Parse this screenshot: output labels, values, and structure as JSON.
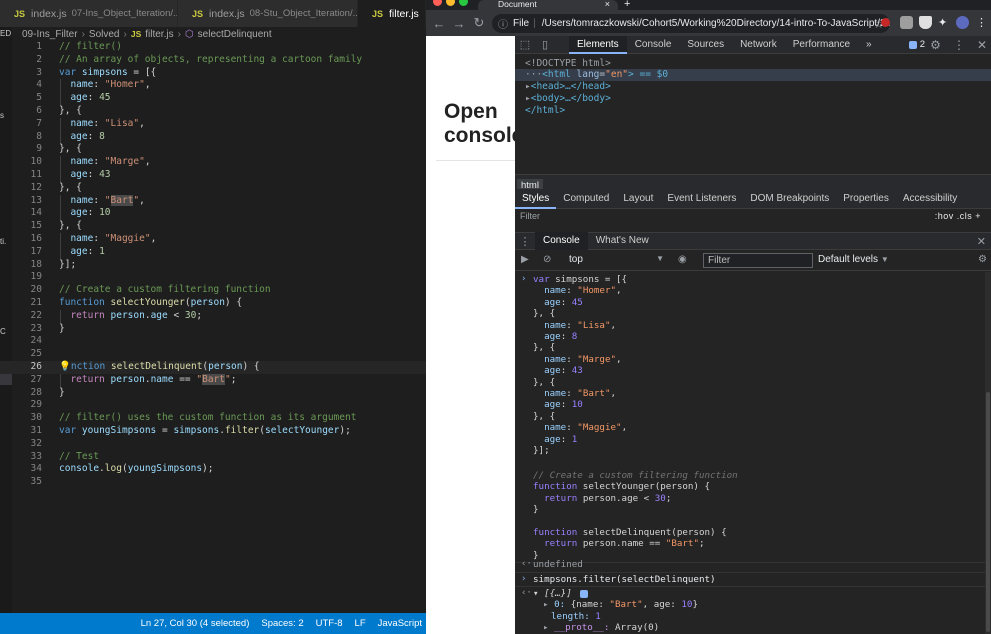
{
  "vscode": {
    "tabs": [
      {
        "icon": "JS",
        "name": "index.js",
        "dir": "07-Ins_Object_Iteration/...",
        "dirty": true
      },
      {
        "icon": "JS",
        "name": "index.js",
        "dir": "08-Stu_Object_Iteration/...",
        "close": "×"
      },
      {
        "icon": "JS",
        "name": "filter.js",
        "active": true
      }
    ],
    "side_letters": [
      "ED",
      "s",
      "ti.",
      "C"
    ],
    "breadcrumb": [
      "09-Ins_Filter",
      "Solved",
      "JS",
      "filter.js",
      "selectDelinquent"
    ],
    "lines": [
      "1",
      "2",
      "3",
      "4",
      "5",
      "6",
      "7",
      "8",
      "9",
      "10",
      "11",
      "12",
      "13",
      "14",
      "15",
      "16",
      "17",
      "18",
      "19",
      "20",
      "21",
      "22",
      "23",
      "24",
      "25",
      "26",
      "27",
      "28",
      "29",
      "30",
      "31",
      "32",
      "33",
      "34",
      "35"
    ],
    "code": {
      "l1": "// filter()",
      "l2": "// An array of objects, representing a cartoon family",
      "l3_kw": "var",
      "l3_var": "simpsons",
      "l3_rest": " = [{",
      "name_key": "name",
      "age_key": "age",
      "homer": "\"Homer\"",
      "age45": "45",
      "lisa": "\"Lisa\"",
      "age8": "8",
      "marge": "\"Marge\"",
      "age43": "43",
      "bart_a": "\"",
      "bart_b": "Bart",
      "bart_c": "\"",
      "age10": "10",
      "maggie": "\"Maggie\"",
      "age1": "1",
      "close_open": "}, {",
      "l18": "}];",
      "l20": "// Create a custom filtering function",
      "l21_kw": "function",
      "l21_fn": "selectYounger",
      "l21_param": "person",
      "l22_kw": "return",
      "l22_obj": "person",
      "l22_prop": "age",
      "l22_rest": " < ",
      "l22_num": "30",
      "l27_partial": "nction",
      "l27_fn": "selectDelinquent",
      "l27_param": "person",
      "l28_kw": "return",
      "l28_obj": "person",
      "l28_prop": "name",
      "l28_eq": " == ",
      "l28_q": "\"",
      "l28_hl": "Bart",
      "l30": "// filter() uses the custom function as its argument",
      "l31_kw": "var",
      "l31_var": "youngSimpsons",
      "l31_obj": "simpsons",
      "l31_fn": "filter",
      "l31_arg": "selectYounger",
      "l33": "// Test",
      "l34_obj": "console",
      "l34_fn": "log",
      "l34_arg": "youngSimpsons"
    },
    "status": {
      "position": "Ln 27, Col 30 (4 selected)",
      "spaces": "Spaces: 2",
      "encoding": "UTF-8",
      "eol": "LF",
      "language": "JavaScript"
    },
    "colors": {
      "status_bar": "#007acc",
      "editor_bg": "#1e1e1e"
    }
  },
  "chrome": {
    "tab_title": "Document",
    "tab_close": "×",
    "new_tab": "+",
    "omnibox_label": "File",
    "omnibox_url": "/Users/tomraczkowski/Cohort5/Working%20Directory/14-intro-To-JavaScript/2/...",
    "page_heading_line1": "Open",
    "page_heading_line2": "console",
    "devtools": {
      "tabs": [
        "Elements",
        "Console",
        "Sources",
        "Network",
        "Performance"
      ],
      "more": "»",
      "badge_count": "2",
      "elements": {
        "doctype": "<!DOCTYPE html>",
        "html_open": "<html",
        "html_attr": "lang",
        "html_val": "\"en\"",
        "html_tail": "> == $0",
        "head": "<head>…</head>",
        "body": "<body>…</body>",
        "html_close": "</html>"
      },
      "crumb": "html",
      "style_tabs": [
        "Styles",
        "Computed",
        "Layout",
        "Event Listeners",
        "DOM Breakpoints",
        "Properties",
        "Accessibility"
      ],
      "filter_placeholder": "Filter",
      "filter_right": ":hov  .cls  +",
      "drawer_tabs": [
        "Console",
        "What's New"
      ],
      "context": "top",
      "console_filter": "Filter",
      "levels": "Default levels",
      "console": {
        "l1_kw": "var",
        "l1_rest": " simpsons = [{",
        "k_name": "name",
        "k_age": "age",
        "homer": "\"Homer\"",
        "a45": "45",
        "lisa": "\"Lisa\"",
        "a8": "8",
        "marge": "\"Marge\"",
        "a43": "43",
        "bart": "\"Bart\"",
        "a10": "10",
        "maggie": "\"Maggie\"",
        "a1": "1",
        "sep": "}, {",
        "end": "}];",
        "comment": "// Create a custom filtering function",
        "fn_kw": "function",
        "fn1": " selectYounger(person) {",
        "ret_kw": "return",
        "ret1": " person.age < ",
        "ret1_num": "30",
        "semi": ";",
        "close": "}",
        "fn2": " selectDelinquent(person) {",
        "ret2": " person.name == ",
        "ret2_str": "\"Bart\"",
        "undefined": "undefined",
        "cmd": "simpsons.filter(selectDelinquent)",
        "result_head": "[{…}]",
        "item0_idx": "0:",
        "item0_open": " {name: ",
        "item0_name": "\"Bart\"",
        "item0_mid": ", age: ",
        "item0_age": "10",
        "item0_close": "}",
        "length_key": "length:",
        "length_val": "1",
        "proto_key": "__proto__:",
        "proto_val": " Array(0)"
      }
    }
  }
}
